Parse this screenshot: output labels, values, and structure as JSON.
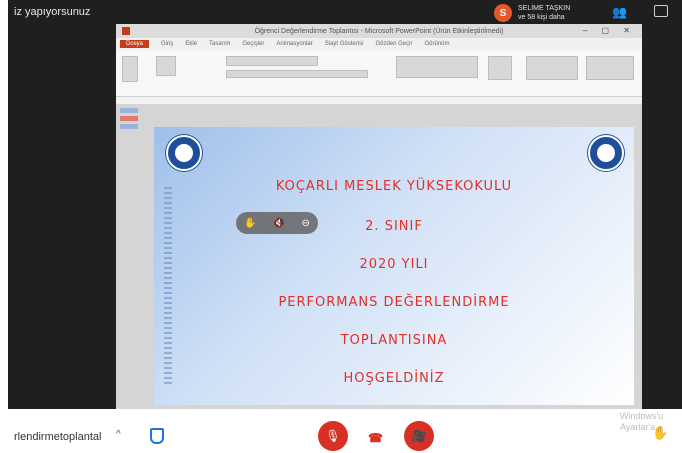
{
  "top": {
    "status_text": "iz yapıyorsunuz",
    "presenter_initial": "S",
    "presenter_name": "SELİME TAŞKIN",
    "presenter_more": "ve 58 kişi daha"
  },
  "ppt": {
    "window_title": "Öğrenci Değerlendirme Toplantısı - Microsoft PowerPoint (Ürün Etkinleştirilmedi)",
    "tabs": [
      "Dosya",
      "Giriş",
      "Ekle",
      "Tasarım",
      "Geçişler",
      "Animasyonlar",
      "Slayt Gösterisi",
      "Gözden Geçir",
      "Görünüm"
    ]
  },
  "slide": {
    "line1": "KOÇARLI MESLEK YÜKSEKOKULU",
    "line2": "2. SINIF",
    "line3": "2020 YILI",
    "line4": "PERFORMANS DEĞERLENDİRME",
    "line5": "TOPLANTISINA",
    "line6": "HOŞGELDİNİZ"
  },
  "bottom": {
    "meeting_name": "rlendirmetoplantal",
    "watermark_line1": "Windows'u",
    "watermark_line2": "Ayarlar'a"
  },
  "colors": {
    "accent_red": "#d93025",
    "slide_text": "#e0302a",
    "ppt_brand": "#c43e1c"
  }
}
